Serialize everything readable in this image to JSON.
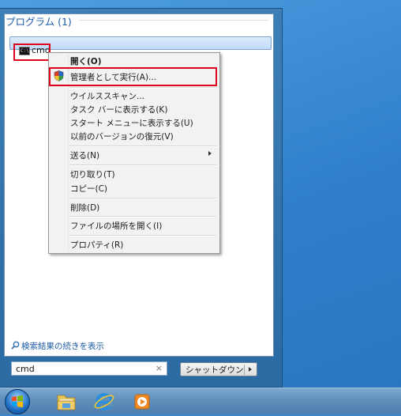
{
  "start_menu": {
    "group_header": "プログラム (1)",
    "result_item": "cmd",
    "see_more": "検索結果の続きを表示",
    "search_value": "cmd",
    "search_clear": "×",
    "shutdown_label": "シャットダウン"
  },
  "context_menu": {
    "items": [
      "開く(O)",
      "管理者として実行(A)...",
      "ウイルススキャン...",
      "タスク バーに表示する(K)",
      "スタート メニューに表示する(U)",
      "以前のバージョンの復元(V)",
      "送る(N)",
      "切り取り(T)",
      "コピー(C)",
      "削除(D)",
      "ファイルの場所を開く(I)",
      "プロパティ(R)"
    ]
  },
  "icons": {
    "cmd": "cmd-icon",
    "shield": "uac-shield-icon",
    "search": "search-icon",
    "start": "windows-start-orb",
    "explorer": "folder-icon",
    "ie": "internet-explorer-icon",
    "media": "media-player-icon"
  }
}
